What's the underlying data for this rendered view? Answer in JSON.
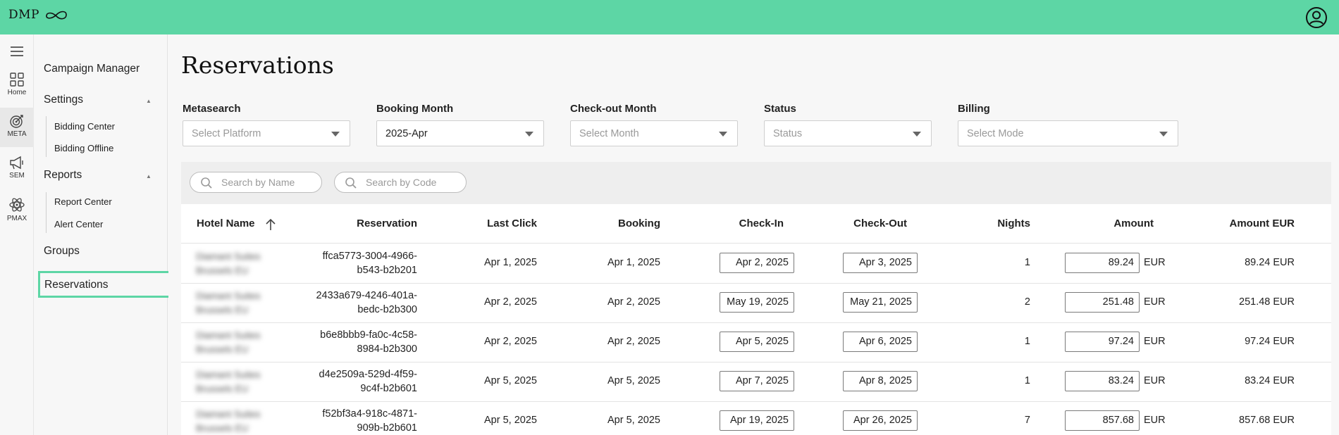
{
  "app": {
    "logo_text": "DMP"
  },
  "rail": {
    "items": [
      {
        "label": "Home",
        "icon": "grid-icon"
      },
      {
        "label": "META",
        "icon": "target-icon"
      },
      {
        "label": "SEM",
        "icon": "megaphone-icon"
      },
      {
        "label": "PMAX",
        "icon": "atom-icon"
      }
    ]
  },
  "sidebar": {
    "campaign_manager": "Campaign Manager",
    "settings": "Settings",
    "settings_items": [
      "Bidding Center",
      "Bidding Offline"
    ],
    "reports": "Reports",
    "reports_items": [
      "Report Center",
      "Alert Center"
    ],
    "groups": "Groups",
    "reservations": "Reservations"
  },
  "page": {
    "title": "Reservations"
  },
  "filters": {
    "metasearch": {
      "label": "Metasearch",
      "placeholder": "Select Platform"
    },
    "booking_month": {
      "label": "Booking Month",
      "value": "2025-Apr"
    },
    "checkout_month": {
      "label": "Check-out Month",
      "placeholder": "Select Month"
    },
    "status": {
      "label": "Status",
      "placeholder": "Status"
    },
    "billing": {
      "label": "Billing",
      "placeholder": "Select Mode"
    }
  },
  "search": {
    "by_name": "Search by Name",
    "by_code": "Search by Code"
  },
  "table": {
    "columns": {
      "hotel_name": "Hotel Name",
      "reservation": "Reservation",
      "last_click": "Last Click",
      "booking": "Booking",
      "check_in": "Check-In",
      "check_out": "Check-Out",
      "nights": "Nights",
      "amount": "Amount",
      "amount_eur": "Amount EUR"
    },
    "rows": [
      {
        "hotel_l1": "Diamant Suites",
        "hotel_l2": "Brussels EU",
        "res_l1": "ffca5773-3004-4966-",
        "res_l2": "b543-b2b201",
        "last_click": "Apr 1, 2025",
        "booking": "Apr 1, 2025",
        "check_in": "Apr 2, 2025",
        "check_out": "Apr 3, 2025",
        "nights": "1",
        "amount": "89.24",
        "currency": "EUR",
        "amount_eur": "89.24 EUR"
      },
      {
        "hotel_l1": "Diamant Suites",
        "hotel_l2": "Brussels EU",
        "res_l1": "2433a679-4246-401a-",
        "res_l2": "bedc-b2b300",
        "last_click": "Apr 2, 2025",
        "booking": "Apr 2, 2025",
        "check_in": "May 19, 2025",
        "check_out": "May 21, 2025",
        "nights": "2",
        "amount": "251.48",
        "currency": "EUR",
        "amount_eur": "251.48 EUR"
      },
      {
        "hotel_l1": "Diamant Suites",
        "hotel_l2": "Brussels EU",
        "res_l1": "b6e8bbb9-fa0c-4c58-",
        "res_l2": "8984-b2b300",
        "last_click": "Apr 2, 2025",
        "booking": "Apr 2, 2025",
        "check_in": "Apr 5, 2025",
        "check_out": "Apr 6, 2025",
        "nights": "1",
        "amount": "97.24",
        "currency": "EUR",
        "amount_eur": "97.24 EUR"
      },
      {
        "hotel_l1": "Diamant Suites",
        "hotel_l2": "Brussels EU",
        "res_l1": "d4e2509a-529d-4f59-",
        "res_l2": "9c4f-b2b601",
        "last_click": "Apr 5, 2025",
        "booking": "Apr 5, 2025",
        "check_in": "Apr 7, 2025",
        "check_out": "Apr 8, 2025",
        "nights": "1",
        "amount": "83.24",
        "currency": "EUR",
        "amount_eur": "83.24 EUR"
      },
      {
        "hotel_l1": "Diamant Suites",
        "hotel_l2": "Brussels EU",
        "res_l1": "f52bf3a4-918c-4871-",
        "res_l2": "909b-b2b601",
        "last_click": "Apr 5, 2025",
        "booking": "Apr 5, 2025",
        "check_in": "Apr 19, 2025",
        "check_out": "Apr 26, 2025",
        "nights": "7",
        "amount": "857.68",
        "currency": "EUR",
        "amount_eur": "857.68 EUR"
      }
    ]
  },
  "colors": {
    "accent": "#5dd6a5"
  }
}
